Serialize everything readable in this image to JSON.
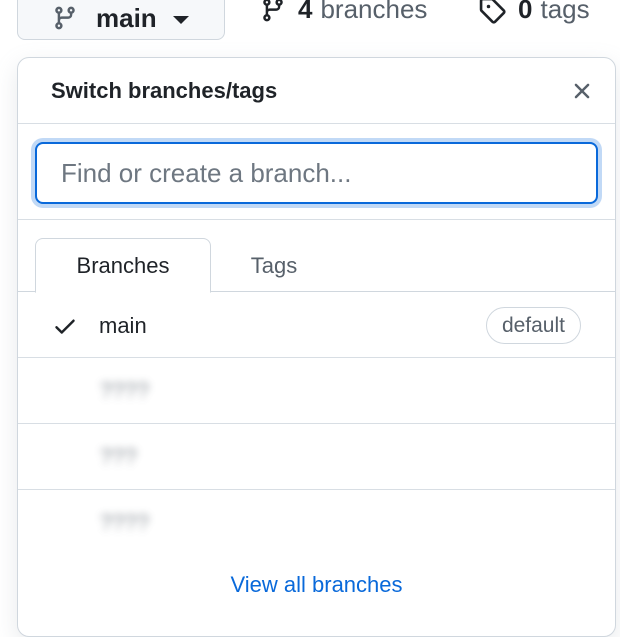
{
  "topbar": {
    "current_branch": "main",
    "branches_count": "4",
    "branches_label": "branches",
    "tags_count": "0",
    "tags_label": "tags"
  },
  "dropdown": {
    "title": "Switch branches/tags",
    "filter": {
      "value": "",
      "placeholder": "Find or create a branch..."
    },
    "tabs": [
      {
        "label": "Branches",
        "selected": true
      },
      {
        "label": "Tags",
        "selected": false
      }
    ],
    "branches": [
      {
        "name": "main",
        "selected": true,
        "badge": "default"
      },
      {
        "name": "????",
        "selected": false
      },
      {
        "name": "???",
        "selected": false
      },
      {
        "name": "????",
        "selected": false
      }
    ],
    "view_all_label": "View all branches"
  },
  "colors": {
    "accent": "#0969da",
    "text": "#1f2328",
    "muted": "#57606a",
    "border": "#d0d7de"
  },
  "icons": [
    "git-branch-icon",
    "caret-down-icon",
    "tag-icon",
    "close-icon",
    "check-icon"
  ]
}
